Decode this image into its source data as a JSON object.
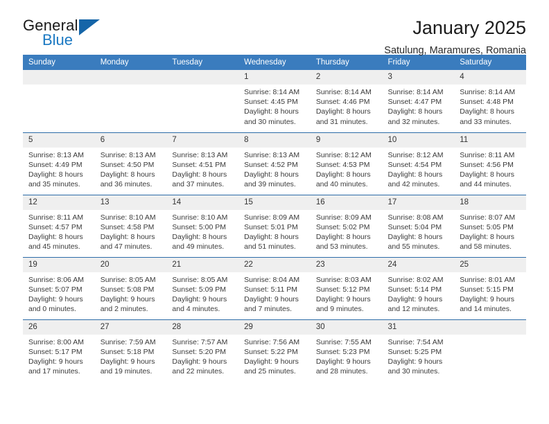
{
  "logo": {
    "word1": "General",
    "word2": "Blue",
    "triangle_color": "#1565a8",
    "blue_text_color": "#1a78c2"
  },
  "header": {
    "title": "January 2025",
    "location": "Satulung, Maramures, Romania"
  },
  "theme": {
    "header_blue": "#3a7cbe",
    "row_divider_blue": "#2c6ca8",
    "daynum_band": "#efefef"
  },
  "calendar": {
    "weekday_headers": [
      "Sunday",
      "Monday",
      "Tuesday",
      "Wednesday",
      "Thursday",
      "Friday",
      "Saturday"
    ],
    "labels": {
      "sunrise": "Sunrise:",
      "sunset": "Sunset:",
      "daylight": "Daylight:"
    },
    "weeks": [
      [
        {
          "day": "",
          "empty": true
        },
        {
          "day": "",
          "empty": true
        },
        {
          "day": "",
          "empty": true
        },
        {
          "day": "1",
          "sunrise": "Sunrise: 8:14 AM",
          "sunset": "Sunset: 4:45 PM",
          "daylight1": "Daylight: 8 hours",
          "daylight2": "and 30 minutes."
        },
        {
          "day": "2",
          "sunrise": "Sunrise: 8:14 AM",
          "sunset": "Sunset: 4:46 PM",
          "daylight1": "Daylight: 8 hours",
          "daylight2": "and 31 minutes."
        },
        {
          "day": "3",
          "sunrise": "Sunrise: 8:14 AM",
          "sunset": "Sunset: 4:47 PM",
          "daylight1": "Daylight: 8 hours",
          "daylight2": "and 32 minutes."
        },
        {
          "day": "4",
          "sunrise": "Sunrise: 8:14 AM",
          "sunset": "Sunset: 4:48 PM",
          "daylight1": "Daylight: 8 hours",
          "daylight2": "and 33 minutes."
        }
      ],
      [
        {
          "day": "5",
          "sunrise": "Sunrise: 8:13 AM",
          "sunset": "Sunset: 4:49 PM",
          "daylight1": "Daylight: 8 hours",
          "daylight2": "and 35 minutes."
        },
        {
          "day": "6",
          "sunrise": "Sunrise: 8:13 AM",
          "sunset": "Sunset: 4:50 PM",
          "daylight1": "Daylight: 8 hours",
          "daylight2": "and 36 minutes."
        },
        {
          "day": "7",
          "sunrise": "Sunrise: 8:13 AM",
          "sunset": "Sunset: 4:51 PM",
          "daylight1": "Daylight: 8 hours",
          "daylight2": "and 37 minutes."
        },
        {
          "day": "8",
          "sunrise": "Sunrise: 8:13 AM",
          "sunset": "Sunset: 4:52 PM",
          "daylight1": "Daylight: 8 hours",
          "daylight2": "and 39 minutes."
        },
        {
          "day": "9",
          "sunrise": "Sunrise: 8:12 AM",
          "sunset": "Sunset: 4:53 PM",
          "daylight1": "Daylight: 8 hours",
          "daylight2": "and 40 minutes."
        },
        {
          "day": "10",
          "sunrise": "Sunrise: 8:12 AM",
          "sunset": "Sunset: 4:54 PM",
          "daylight1": "Daylight: 8 hours",
          "daylight2": "and 42 minutes."
        },
        {
          "day": "11",
          "sunrise": "Sunrise: 8:11 AM",
          "sunset": "Sunset: 4:56 PM",
          "daylight1": "Daylight: 8 hours",
          "daylight2": "and 44 minutes."
        }
      ],
      [
        {
          "day": "12",
          "sunrise": "Sunrise: 8:11 AM",
          "sunset": "Sunset: 4:57 PM",
          "daylight1": "Daylight: 8 hours",
          "daylight2": "and 45 minutes."
        },
        {
          "day": "13",
          "sunrise": "Sunrise: 8:10 AM",
          "sunset": "Sunset: 4:58 PM",
          "daylight1": "Daylight: 8 hours",
          "daylight2": "and 47 minutes."
        },
        {
          "day": "14",
          "sunrise": "Sunrise: 8:10 AM",
          "sunset": "Sunset: 5:00 PM",
          "daylight1": "Daylight: 8 hours",
          "daylight2": "and 49 minutes."
        },
        {
          "day": "15",
          "sunrise": "Sunrise: 8:09 AM",
          "sunset": "Sunset: 5:01 PM",
          "daylight1": "Daylight: 8 hours",
          "daylight2": "and 51 minutes."
        },
        {
          "day": "16",
          "sunrise": "Sunrise: 8:09 AM",
          "sunset": "Sunset: 5:02 PM",
          "daylight1": "Daylight: 8 hours",
          "daylight2": "and 53 minutes."
        },
        {
          "day": "17",
          "sunrise": "Sunrise: 8:08 AM",
          "sunset": "Sunset: 5:04 PM",
          "daylight1": "Daylight: 8 hours",
          "daylight2": "and 55 minutes."
        },
        {
          "day": "18",
          "sunrise": "Sunrise: 8:07 AM",
          "sunset": "Sunset: 5:05 PM",
          "daylight1": "Daylight: 8 hours",
          "daylight2": "and 58 minutes."
        }
      ],
      [
        {
          "day": "19",
          "sunrise": "Sunrise: 8:06 AM",
          "sunset": "Sunset: 5:07 PM",
          "daylight1": "Daylight: 9 hours",
          "daylight2": "and 0 minutes."
        },
        {
          "day": "20",
          "sunrise": "Sunrise: 8:05 AM",
          "sunset": "Sunset: 5:08 PM",
          "daylight1": "Daylight: 9 hours",
          "daylight2": "and 2 minutes."
        },
        {
          "day": "21",
          "sunrise": "Sunrise: 8:05 AM",
          "sunset": "Sunset: 5:09 PM",
          "daylight1": "Daylight: 9 hours",
          "daylight2": "and 4 minutes."
        },
        {
          "day": "22",
          "sunrise": "Sunrise: 8:04 AM",
          "sunset": "Sunset: 5:11 PM",
          "daylight1": "Daylight: 9 hours",
          "daylight2": "and 7 minutes."
        },
        {
          "day": "23",
          "sunrise": "Sunrise: 8:03 AM",
          "sunset": "Sunset: 5:12 PM",
          "daylight1": "Daylight: 9 hours",
          "daylight2": "and 9 minutes."
        },
        {
          "day": "24",
          "sunrise": "Sunrise: 8:02 AM",
          "sunset": "Sunset: 5:14 PM",
          "daylight1": "Daylight: 9 hours",
          "daylight2": "and 12 minutes."
        },
        {
          "day": "25",
          "sunrise": "Sunrise: 8:01 AM",
          "sunset": "Sunset: 5:15 PM",
          "daylight1": "Daylight: 9 hours",
          "daylight2": "and 14 minutes."
        }
      ],
      [
        {
          "day": "26",
          "sunrise": "Sunrise: 8:00 AM",
          "sunset": "Sunset: 5:17 PM",
          "daylight1": "Daylight: 9 hours",
          "daylight2": "and 17 minutes."
        },
        {
          "day": "27",
          "sunrise": "Sunrise: 7:59 AM",
          "sunset": "Sunset: 5:18 PM",
          "daylight1": "Daylight: 9 hours",
          "daylight2": "and 19 minutes."
        },
        {
          "day": "28",
          "sunrise": "Sunrise: 7:57 AM",
          "sunset": "Sunset: 5:20 PM",
          "daylight1": "Daylight: 9 hours",
          "daylight2": "and 22 minutes."
        },
        {
          "day": "29",
          "sunrise": "Sunrise: 7:56 AM",
          "sunset": "Sunset: 5:22 PM",
          "daylight1": "Daylight: 9 hours",
          "daylight2": "and 25 minutes."
        },
        {
          "day": "30",
          "sunrise": "Sunrise: 7:55 AM",
          "sunset": "Sunset: 5:23 PM",
          "daylight1": "Daylight: 9 hours",
          "daylight2": "and 28 minutes."
        },
        {
          "day": "31",
          "sunrise": "Sunrise: 7:54 AM",
          "sunset": "Sunset: 5:25 PM",
          "daylight1": "Daylight: 9 hours",
          "daylight2": "and 30 minutes."
        },
        {
          "day": "",
          "empty": true
        }
      ]
    ]
  }
}
